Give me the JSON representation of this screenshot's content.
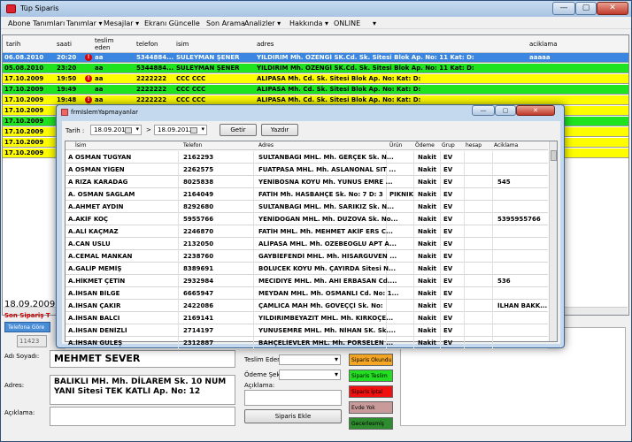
{
  "window": {
    "title": "Tüp Siparis",
    "controls": [
      "—",
      "▢",
      "✕"
    ]
  },
  "menu": [
    "Abone Tanımları",
    "Tanımlar ▾",
    "Mesajlar ▾",
    "Ekranı Güncelle",
    "Son Arama",
    "Analizler ▾",
    "Hakkında ▾",
    "ONLINE",
    "▾"
  ],
  "orders_grid": {
    "columns": [
      "tarih",
      "saati",
      "teslim eden",
      "telefon",
      "isim",
      "adres",
      "aciklama"
    ],
    "rows": [
      {
        "tarih": "06.08.2010",
        "saati": "20:20",
        "warn": true,
        "teslim": "aa",
        "telefon": "5344884...",
        "isim": "SÜLEYMAN ŞENER",
        "adres": "YILDIRIM Mh. ÖZENGİ SK.Cd.  Sk.  Sitesi  Blok  Ap. No: 11 Kat:  D:",
        "aciklama": "aaaaa",
        "color": "blue"
      },
      {
        "tarih": "05.08.2010",
        "saati": "23:20",
        "warn": false,
        "teslim": "aa",
        "telefon": "5344884...",
        "isim": "SÜLEYMAN ŞENER",
        "adres": "YILDIRIM Mh. ÖZENGİ SK.Cd.  Sk.  Sitesi  Blok  Ap. No: 11 Kat:  D:",
        "aciklama": "",
        "color": "green"
      },
      {
        "tarih": "17.10.2009",
        "saati": "19:50",
        "warn": true,
        "teslim": "aa",
        "telefon": "2222222",
        "isim": "CCC CCC",
        "adres": "ALIPASA Mh.  Cd.  Sk.  Sitesi  Blok  Ap. No:  Kat:  D:",
        "aciklama": "",
        "color": "yellow"
      },
      {
        "tarih": "17.10.2009",
        "saati": "19:49",
        "warn": false,
        "teslim": "aa",
        "telefon": "2222222",
        "isim": "CCC CCC",
        "adres": "ALIPASA Mh.  Cd.  Sk.  Sitesi  Blok  Ap. No:  Kat:  D:",
        "aciklama": "",
        "color": "green"
      },
      {
        "tarih": "17.10.2009",
        "saati": "19:48",
        "warn": true,
        "teslim": "aa",
        "telefon": "2222222",
        "isim": "CCC CCC",
        "adres": "ALIPASA Mh.  Cd.  Sk.  Sitesi  Blok  Ap. No:  Kat:  D:",
        "aciklama": "",
        "color": "yellow"
      },
      {
        "tarih": "17.10.2009",
        "saati": "",
        "warn": false,
        "teslim": "",
        "telefon": "",
        "isim": "",
        "adres": "",
        "aciklama": "",
        "color": "yellow"
      },
      {
        "tarih": "17.10.2009",
        "saati": "",
        "warn": false,
        "teslim": "",
        "telefon": "",
        "isim": "",
        "adres": "",
        "aciklama": "",
        "color": "green"
      },
      {
        "tarih": "17.10.2009",
        "saati": "",
        "warn": false,
        "teslim": "",
        "telefon": "",
        "isim": "",
        "adres": "",
        "aciklama": "",
        "color": "yellow"
      },
      {
        "tarih": "17.10.2009",
        "saati": "",
        "warn": false,
        "teslim": "",
        "telefon": "",
        "isim": "",
        "adres": "",
        "aciklama": "",
        "color": "yellow"
      },
      {
        "tarih": "17.10.2009",
        "saati": "",
        "warn": false,
        "teslim": "",
        "telefon": "",
        "isim": "",
        "adres": "",
        "aciklama": "",
        "color": "yellow"
      }
    ]
  },
  "order_form": {
    "date": "18.09.2009",
    "section_title": "Son Sipariş T",
    "tab_label": "Telefona Göre",
    "id_value": "11423",
    "name_label": "Adı Soyadı:",
    "name_value": "MEHMET  SEVER",
    "address_label": "Adres:",
    "address_value": "BALIKLI MH. Mh. DİLAREM Sk. 10 NUM YANI Sitesi TEK KATLI Ap. No: 12",
    "note_label": "Açıklama:",
    "delivered_by_label": "Teslim Eden:",
    "payment_label": "Ödeme Şekli:",
    "note2_label": "Açıklama:",
    "add_button": "Siparis Ekle",
    "statuses": [
      {
        "label": "Siparis Okundu",
        "color": "#f5a623"
      },
      {
        "label": "Siparis Teslim",
        "color": "#22dd22"
      },
      {
        "label": "Siparis İptal",
        "color": "#f01010"
      },
      {
        "label": "Evde Yok",
        "color": "#c89a9a"
      },
      {
        "label": "Gecerlesmiş",
        "color": "#2e8b2e"
      }
    ]
  },
  "dialog": {
    "title": "frmIslemYapmayanlar",
    "date_label": "Tarih :",
    "date_from": "18.09.2012",
    "arrow": ">",
    "date_to": "18.09.2012",
    "get_button": "Getir",
    "print_button": "Yazdır",
    "columns": [
      "İsim",
      "Telefon",
      "Adres",
      "Ürün",
      "Ödeme",
      "Grup",
      "hesap",
      "Aciklama"
    ],
    "rows": [
      {
        "isim": "A OSMAN TUĞYAN",
        "telefon": "2162293",
        "adres": "SULTANBAGI MHL. Mh. GERÇEK Sk. N...",
        "urun": "",
        "odeme": "Nakit",
        "grup": "EV",
        "hesap": "",
        "aciklama": ""
      },
      {
        "isim": "A OSMAN YİĞEN",
        "telefon": "2262575",
        "adres": "FUATPASA MHL. Mh. ASLANÖNAL SIT ...",
        "urun": "",
        "odeme": "Nakit",
        "grup": "EV",
        "hesap": "",
        "aciklama": ""
      },
      {
        "isim": "A RIZA KARADAĞ",
        "telefon": "8025838",
        "adres": "YENİBOSNA KÖYÜ Mh. YUNUS EMRE ...",
        "urun": "",
        "odeme": "Nakit",
        "grup": "EV",
        "hesap": "",
        "aciklama": "545"
      },
      {
        "isim": "A. OSMAN SAĞLAM",
        "telefon": "2164049",
        "adres": "FATİH Mh. HASBAHÇE Sk. No: 7 D: 3",
        "urun": "PIKNIK",
        "odeme": "Nakit",
        "grup": "EV",
        "hesap": "",
        "aciklama": ""
      },
      {
        "isim": "A.AHMET AYDIN",
        "telefon": "8292680",
        "adres": "SULTANBAGI MHL. Mh. SARIKIZ Sk. N...",
        "urun": "",
        "odeme": "Nakit",
        "grup": "EV",
        "hesap": "",
        "aciklama": ""
      },
      {
        "isim": "A.AKİF KOÇ",
        "telefon": "5955766",
        "adres": "YENİDOGAN MHL. Mh. DÜZOVA Sk. No...",
        "urun": "",
        "odeme": "Nakit",
        "grup": "EV",
        "hesap": "",
        "aciklama": "5395955766"
      },
      {
        "isim": "A.ALİ KAÇMAZ",
        "telefon": "2246870",
        "adres": "FATİH MHL. Mh. MEHMET AKİF ERS C...",
        "urun": "",
        "odeme": "Nakit",
        "grup": "EV",
        "hesap": "",
        "aciklama": ""
      },
      {
        "isim": "A.CAN USLU",
        "telefon": "2132050",
        "adres": "ALİPASA MHL. Mh. ÖZEBEOĞLU APT A...",
        "urun": "",
        "odeme": "Nakit",
        "grup": "EV",
        "hesap": "",
        "aciklama": ""
      },
      {
        "isim": "A.CEMAL MANKAN",
        "telefon": "2238760",
        "adres": "GAYBİEFENDİ MHL. Mh. HISARGÜVEN ...",
        "urun": "",
        "odeme": "Nakit",
        "grup": "EV",
        "hesap": "",
        "aciklama": ""
      },
      {
        "isim": "A.GALİP MEMİŞ",
        "telefon": "8389691",
        "adres": "BÖLÜCEK KÖYÜ Mh. ÇAYIRDA Sitesi N...",
        "urun": "",
        "odeme": "Nakit",
        "grup": "EV",
        "hesap": "",
        "aciklama": ""
      },
      {
        "isim": "A.HİKMET ÇETİN",
        "telefon": "2932984",
        "adres": "MECIDIYE MHL. Mh. AHI ERBASAN Cd....",
        "urun": "",
        "odeme": "Nakit",
        "grup": "EV",
        "hesap": "",
        "aciklama": "536"
      },
      {
        "isim": "A.İHSAN BİLGE",
        "telefon": "6665947",
        "adres": "MEYDAN MHL. Mh. OSMANLI Cd. No: 1...",
        "urun": "",
        "odeme": "Nakit",
        "grup": "EV",
        "hesap": "",
        "aciklama": ""
      },
      {
        "isim": "A.İHSAN ÇAKIR",
        "telefon": "2422086",
        "adres": "ÇAMLICA MAH Mh. GÖVEÇÇİ Sk. No:",
        "urun": "",
        "odeme": "Nakit",
        "grup": "EV",
        "hesap": "",
        "aciklama": "İLHAN BAKK..."
      },
      {
        "isim": "A.İHSAN BALCI",
        "telefon": "2169141",
        "adres": "YILDIRIMBEYAZIT MHL. Mh. KIRKÖÇE...",
        "urun": "",
        "odeme": "Nakit",
        "grup": "EV",
        "hesap": "",
        "aciklama": ""
      },
      {
        "isim": "A.İHSAN DENİZLİ",
        "telefon": "2714197",
        "adres": "YUNUSEMRE MHL. Mh. NİHAN SK. Sk....",
        "urun": "",
        "odeme": "Nakit",
        "grup": "EV",
        "hesap": "",
        "aciklama": ""
      },
      {
        "isim": "A.İHSAN GÜLEŞ",
        "telefon": "2312887",
        "adres": "BAHÇELİEVLER MHL. Mh. PORSELEN ...",
        "urun": "",
        "odeme": "Nakit",
        "grup": "EV",
        "hesap": "",
        "aciklama": ""
      }
    ]
  },
  "colors": {
    "blue": "#3b86e0",
    "green": "#1fe31f",
    "yellow": "#fdfd00"
  }
}
